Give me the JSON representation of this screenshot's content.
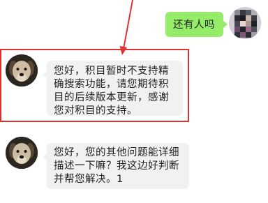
{
  "chat": {
    "outgoing": {
      "text": "还有人吗"
    },
    "incoming": [
      {
        "text": "您好，积目暂时不支持精确搜索功能，请您期待积目的后续版本更新，感谢您对积目的支持。"
      },
      {
        "text": "您好，您的其他问题能详细描述一下嘛？我这边好判断并帮您解决。1"
      }
    ]
  },
  "colors": {
    "outgoing_bubble": "#95ec69",
    "incoming_bubble": "#f1f1f1",
    "highlight": "#e03131"
  },
  "icons": {
    "user_avatar": "pixelated-user-avatar",
    "agent_avatar": "dog-avatar",
    "annotation": "red-arrow"
  }
}
